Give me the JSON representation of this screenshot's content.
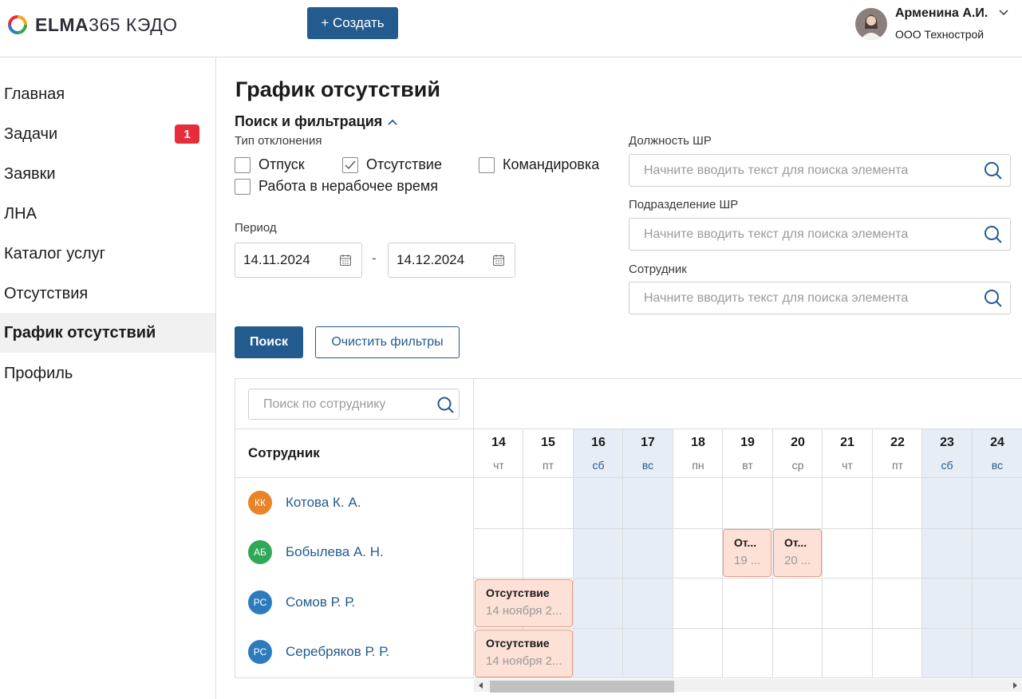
{
  "header": {
    "logo_bold": "ELMA",
    "logo_rest": "365 КЭДО",
    "create_label": "+ Создать",
    "user_name": "Арменина А.И.",
    "user_org": "ООО Технострой"
  },
  "sidebar": {
    "items": [
      {
        "label": "Главная"
      },
      {
        "label": "Задачи",
        "badge": "1"
      },
      {
        "label": "Заявки"
      },
      {
        "label": "ЛНА"
      },
      {
        "label": "Каталог услуг"
      },
      {
        "label": "Отсутствия"
      },
      {
        "label": "График отсутствий",
        "active": true
      },
      {
        "label": "Профиль"
      }
    ]
  },
  "main": {
    "title": "График отсутствий",
    "filter_toggle": "Поиск и фильтрация",
    "deviation_type_label": "Тип отклонения",
    "checkboxes": [
      {
        "label": "Отпуск",
        "checked": false
      },
      {
        "label": "Отсутствие",
        "checked": true
      },
      {
        "label": "Командировка",
        "checked": false
      },
      {
        "label": "Работа в нерабочее время",
        "checked": false
      }
    ],
    "period_label": "Период",
    "date_from": "14.11.2024",
    "date_to": "14.12.2024",
    "date_dash": "-",
    "position_label": "Должность ШР",
    "division_label": "Подразделение ШР",
    "employee_label": "Сотрудник",
    "search_placeholder": "Начните вводить текст для поиска элемента",
    "search_button": "Поиск",
    "clear_button": "Очистить фильтры"
  },
  "schedule": {
    "employee_search_placeholder": "Поиск по сотруднику",
    "employee_column": "Сотрудник",
    "days": [
      {
        "num": "14",
        "wd": "чт",
        "weekend": false
      },
      {
        "num": "15",
        "wd": "пт",
        "weekend": false
      },
      {
        "num": "16",
        "wd": "сб",
        "weekend": true
      },
      {
        "num": "17",
        "wd": "вс",
        "weekend": true
      },
      {
        "num": "18",
        "wd": "пн",
        "weekend": false
      },
      {
        "num": "19",
        "wd": "вт",
        "weekend": false
      },
      {
        "num": "20",
        "wd": "ср",
        "weekend": false
      },
      {
        "num": "21",
        "wd": "чт",
        "weekend": false
      },
      {
        "num": "22",
        "wd": "пт",
        "weekend": false
      },
      {
        "num": "23",
        "wd": "сб",
        "weekend": true
      },
      {
        "num": "24",
        "wd": "вс",
        "weekend": true
      }
    ],
    "employees": [
      {
        "initials": "КК",
        "name": "Котова К. А.",
        "color": "#e8832a"
      },
      {
        "initials": "АБ",
        "name": "Бобылева А. Н.",
        "color": "#2fa858"
      },
      {
        "initials": "РС",
        "name": "Сомов Р. Р.",
        "color": "#2d7bbf"
      },
      {
        "initials": "РС",
        "name": "Серебряков Р. Р.",
        "color": "#2d7bbf"
      }
    ],
    "absences": [
      {
        "title": "От...",
        "date": "19 ..."
      },
      {
        "title": "От...",
        "date": "20 ..."
      },
      {
        "title": "Отсутствие",
        "date": "14 ноября 2..."
      },
      {
        "title": "Отсутствие",
        "date": "14 ноября 2..."
      }
    ]
  }
}
